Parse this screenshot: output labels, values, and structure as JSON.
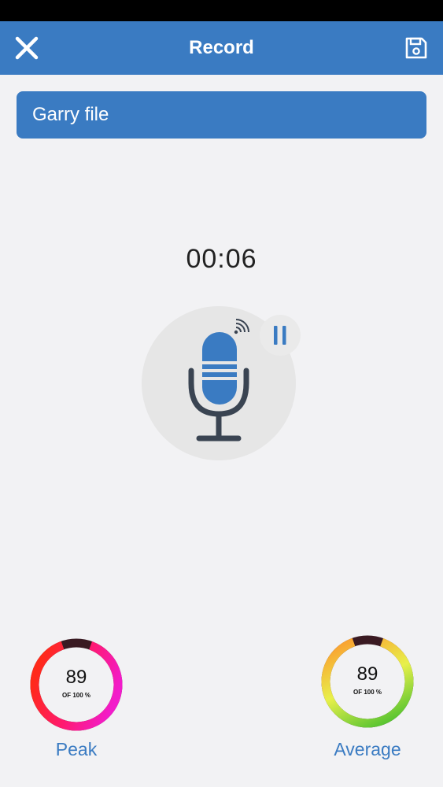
{
  "header": {
    "title": "Record",
    "close_icon": "close-icon",
    "save_icon": "save-icon",
    "color": "#3a7bc2"
  },
  "recording_name": "Garry file",
  "timer": "00:06",
  "mic": {
    "icon": "microphone-icon",
    "signal_icon": "signal-icon",
    "pause_icon": "pause-icon",
    "accent": "#3a7bc2"
  },
  "meters": {
    "peak": {
      "value": "89",
      "of_label": "OF 100 %",
      "caption": "Peak",
      "fraction": 0.89
    },
    "average": {
      "value": "89",
      "of_label": "OF 100 %",
      "caption": "Average",
      "fraction": 0.89
    }
  }
}
